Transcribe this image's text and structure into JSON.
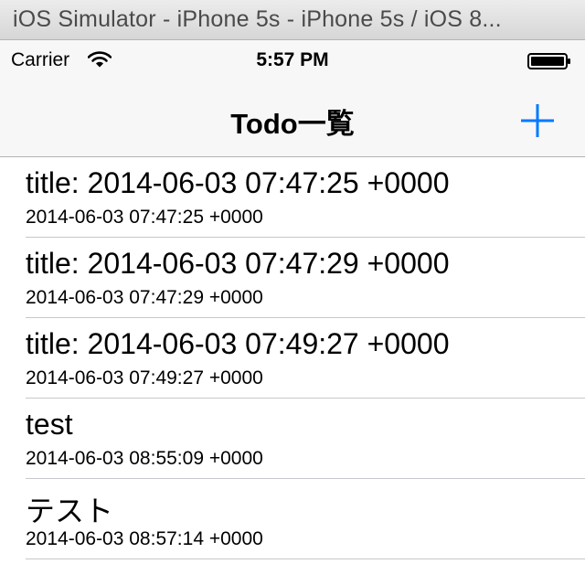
{
  "window": {
    "title": "iOS Simulator - iPhone 5s - iPhone 5s / iOS 8..."
  },
  "status_bar": {
    "carrier": "Carrier",
    "time": "5:57 PM"
  },
  "nav": {
    "title": "Todo一覧",
    "add_icon": "plus-icon"
  },
  "colors": {
    "tint": "#007aff",
    "separator": "#c8c7cc",
    "bar_background": "#f7f7f7"
  },
  "todos": [
    {
      "title": "title: 2014-06-03 07:47:25 +0000",
      "subtitle": "2014-06-03 07:47:25 +0000"
    },
    {
      "title": "title: 2014-06-03 07:47:29 +0000",
      "subtitle": "2014-06-03 07:47:29 +0000"
    },
    {
      "title": "title: 2014-06-03 07:49:27 +0000",
      "subtitle": "2014-06-03 07:49:27 +0000"
    },
    {
      "title": "test",
      "subtitle": "2014-06-03 08:55:09 +0000"
    },
    {
      "title": "テスト",
      "subtitle": "2014-06-03 08:57:14 +0000"
    }
  ]
}
